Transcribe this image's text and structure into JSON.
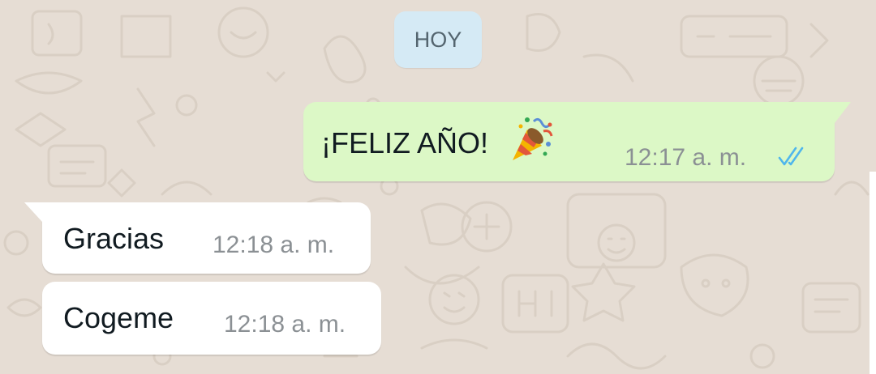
{
  "date_separator": "HOY",
  "messages": [
    {
      "direction": "outgoing",
      "text": "¡FELIZ AÑO!",
      "emoji": "party-popper",
      "time": "12:17 a. m.",
      "status": "read"
    },
    {
      "direction": "incoming",
      "text": "Gracias",
      "time": "12:18 a. m."
    },
    {
      "direction": "incoming",
      "text": "Cogeme",
      "time": "12:18 a. m."
    }
  ],
  "colors": {
    "wallpaper": "#e6ddd4",
    "outgoing_bubble": "#dcf8c6",
    "incoming_bubble": "#ffffff",
    "date_chip": "#d5eaf5",
    "read_ticks": "#4fb6ec"
  }
}
